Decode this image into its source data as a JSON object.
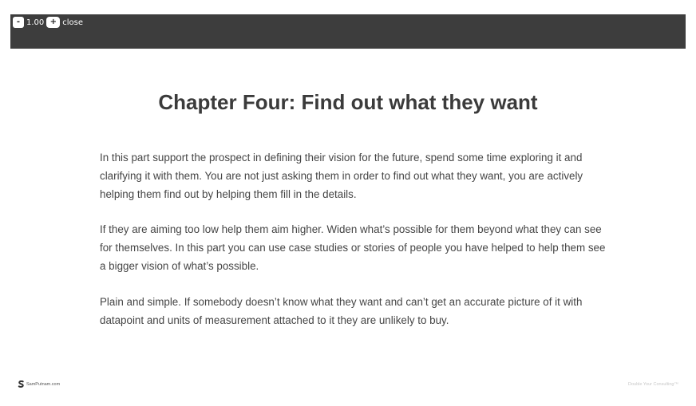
{
  "toolbar": {
    "zoom_out_label": "-",
    "zoom_level": "1.00",
    "zoom_in_label": "+",
    "close_label": "close"
  },
  "slide": {
    "title": "Chapter Four: Find out what they want",
    "paragraphs": [
      "In this part support the prospect in defining their vision for the future, spend some time exploring it and clarifying it with them. You are not just asking them in order to find out what they want, you are actively helping them find out by helping them fill in the details.",
      "If they are aiming too low help them aim higher. Widen what’s possible for them beyond what they can see for themselves. In this part you can use case studies or stories of people you have helped to help them see a bigger vision of what’s possible.",
      "Plain and simple. If somebody doesn’t know what they want and can’t get an accurate picture of it with datapoint and units of measurement attached to it they are unlikely to buy."
    ],
    "footer_left": "SamPutnam.com",
    "footer_right": "Double Your Consulting™"
  },
  "colors": {
    "toolbar_bg": "#3d3d3d",
    "title_text": "#3b3b3b",
    "body_text": "#454545"
  },
  "icons": {
    "footer_logo": "samputnam-logo-icon"
  }
}
